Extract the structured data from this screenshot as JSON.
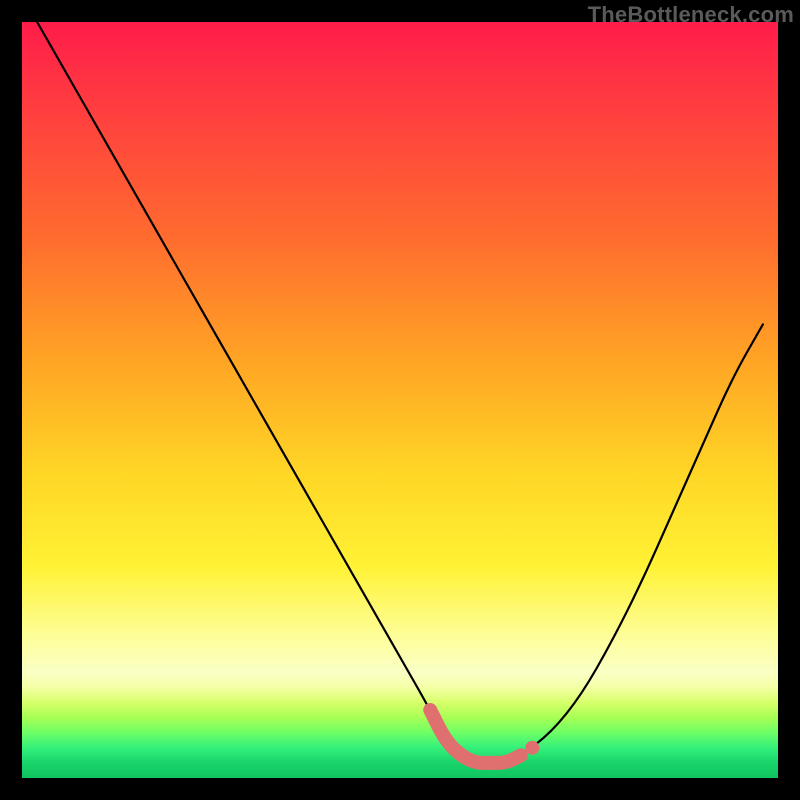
{
  "watermark": "TheBottleneck.com",
  "colors": {
    "frame": "#000000",
    "watermark": "#5a5a5a",
    "curve": "#000000",
    "marker": "#e07070",
    "gradient_top": "#ff1c4a",
    "gradient_bottom": "#10c45f"
  },
  "chart_data": {
    "type": "line",
    "title": "",
    "xlabel": "",
    "ylabel": "",
    "xlim": [
      0,
      100
    ],
    "ylim": [
      0,
      100
    ],
    "grid": false,
    "legend": false,
    "series": [
      {
        "name": "bottleneck-curve",
        "x": [
          2,
          6,
          10,
          14,
          18,
          22,
          26,
          30,
          34,
          38,
          42,
          46,
          50,
          54,
          56,
          58,
          60,
          62,
          64,
          66,
          70,
          74,
          78,
          82,
          86,
          90,
          94,
          98
        ],
        "values": [
          100,
          93,
          86,
          79,
          72,
          65,
          58,
          51,
          44,
          37,
          30,
          23,
          16,
          9,
          5,
          3,
          2,
          2,
          2,
          3,
          6,
          11,
          18,
          26,
          35,
          44,
          53,
          60
        ]
      }
    ],
    "annotations": [
      {
        "name": "valley-floor-marker",
        "x": [
          54,
          56,
          58,
          60,
          62,
          64,
          66
        ],
        "values": [
          9,
          5,
          3,
          2,
          2,
          2,
          3
        ],
        "style": "thick-muted-red"
      },
      {
        "name": "right-dot-marker",
        "x": 67.5,
        "value": 4,
        "style": "dot"
      }
    ]
  }
}
